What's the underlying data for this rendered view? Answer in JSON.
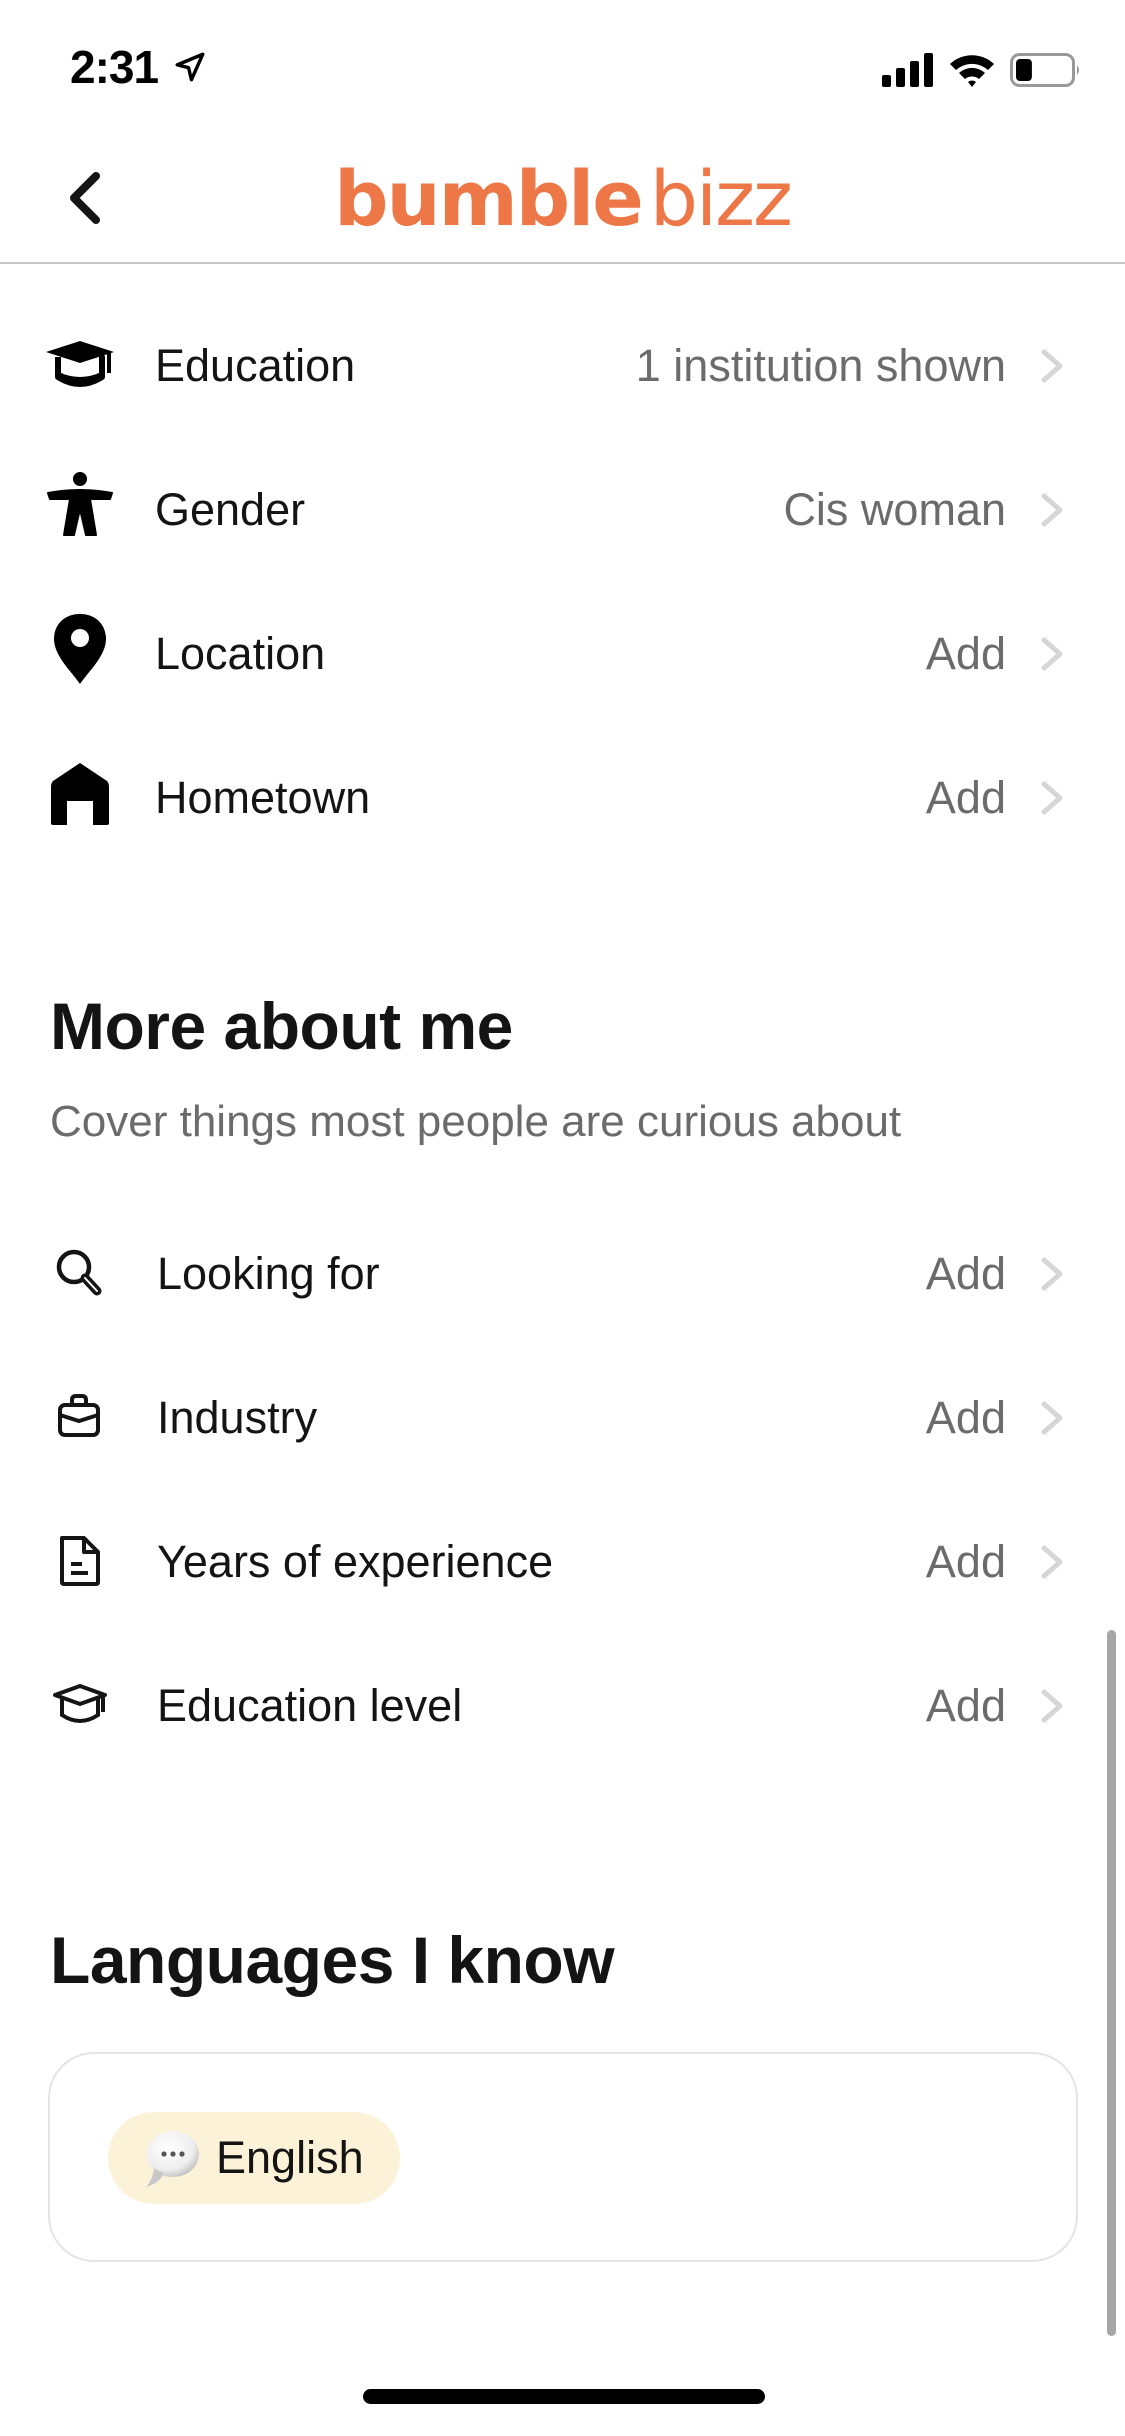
{
  "status_bar": {
    "time": "2:31",
    "location_icon": "location-arrow-icon",
    "signal_icon": "cellular-signal-icon",
    "wifi_icon": "wifi-icon",
    "battery_icon": "battery-icon",
    "battery_level_percent": 30
  },
  "header": {
    "back_icon": "chevron-left-icon",
    "logo_part1": "bumble",
    "logo_part2": "bizz",
    "brand_color": "#ee7747"
  },
  "basics": {
    "items": [
      {
        "label": "Education",
        "value": "1 institution shown",
        "icon": "graduation-cap-icon"
      },
      {
        "label": "Gender",
        "value": "Cis woman",
        "icon": "person-icon"
      },
      {
        "label": "Location",
        "value": "Add",
        "icon": "map-pin-icon"
      },
      {
        "label": "Hometown",
        "value": "Add",
        "icon": "house-icon"
      }
    ]
  },
  "more_about_me": {
    "title": "More about me",
    "subtitle": "Cover things most people are curious about",
    "items": [
      {
        "label": "Looking for",
        "value": "Add",
        "icon": "search-icon"
      },
      {
        "label": "Industry",
        "value": "Add",
        "icon": "briefcase-icon"
      },
      {
        "label": "Years of experience",
        "value": "Add",
        "icon": "document-icon"
      },
      {
        "label": "Education level",
        "value": "Add",
        "icon": "graduation-cap-outline-icon"
      }
    ]
  },
  "languages": {
    "title": "Languages I know",
    "chips": [
      {
        "label": "English",
        "icon": "speech-bubble-icon"
      }
    ],
    "chip_color": "#fcf2d7"
  },
  "colors": {
    "text_primary": "#141414",
    "text_secondary": "#6b6b6b",
    "chevron": "#d6d6d6",
    "divider": "#c9c9c9"
  }
}
